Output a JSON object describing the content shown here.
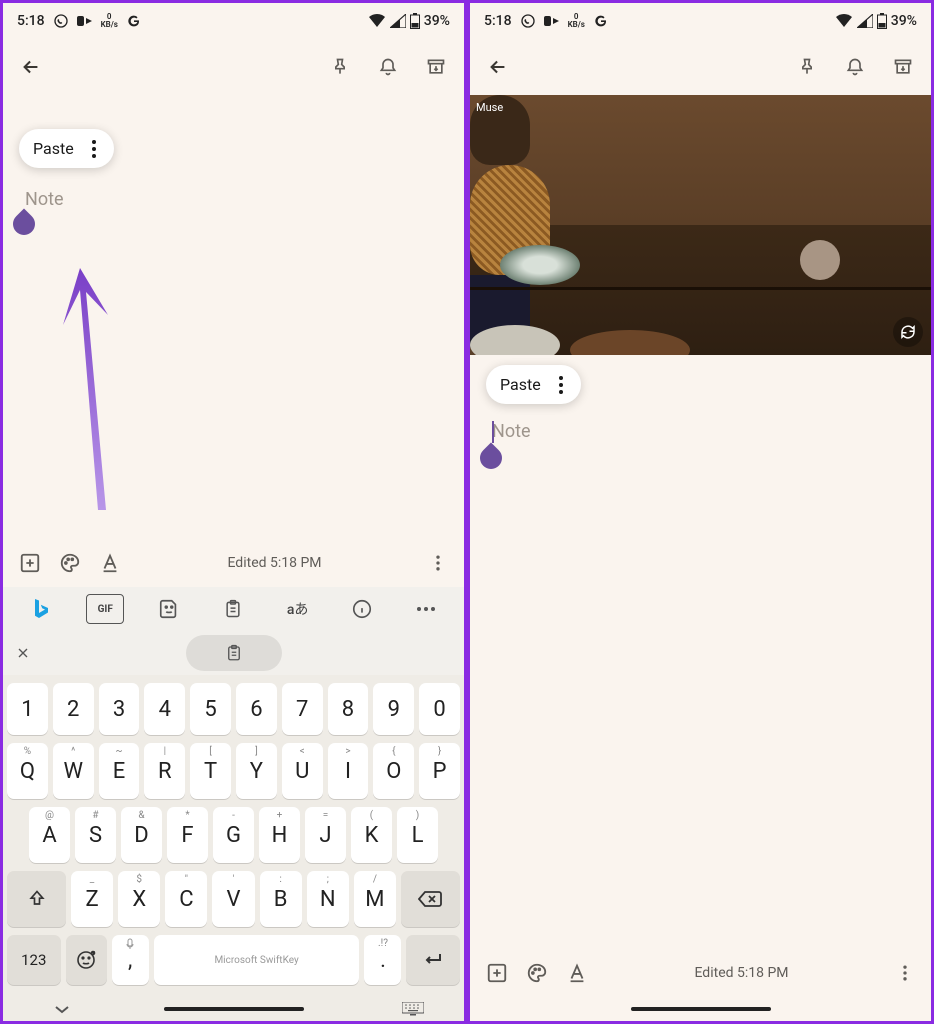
{
  "status": {
    "time": "5:18",
    "kb_num": "0",
    "kb_unit": "KB/s",
    "battery": "39%"
  },
  "left": {
    "paste_label": "Paste",
    "note_placeholder": "Note",
    "edited": "Edited 5:18 PM"
  },
  "right": {
    "paste_label": "Paste",
    "note_placeholder": "Note",
    "edited": "Edited 5:18 PM",
    "poster_text": "Muse"
  },
  "keyboard": {
    "gif": "GIF",
    "lang": "aあ",
    "row_num": [
      "1",
      "2",
      "3",
      "4",
      "5",
      "6",
      "7",
      "8",
      "9",
      "0"
    ],
    "row_q": [
      {
        "m": "Q",
        "s": "%"
      },
      {
        "m": "W",
        "s": "^"
      },
      {
        "m": "E",
        "s": "~"
      },
      {
        "m": "R",
        "s": "|"
      },
      {
        "m": "T",
        "s": "["
      },
      {
        "m": "Y",
        "s": "]"
      },
      {
        "m": "U",
        "s": "<"
      },
      {
        "m": "I",
        "s": ">"
      },
      {
        "m": "O",
        "s": "{"
      },
      {
        "m": "P",
        "s": "}"
      }
    ],
    "row_a": [
      {
        "m": "A",
        "s": "@"
      },
      {
        "m": "S",
        "s": "#"
      },
      {
        "m": "D",
        "s": "&"
      },
      {
        "m": "F",
        "s": "*"
      },
      {
        "m": "G",
        "s": "-"
      },
      {
        "m": "H",
        "s": "+"
      },
      {
        "m": "J",
        "s": "="
      },
      {
        "m": "K",
        "s": "("
      },
      {
        "m": "L",
        "s": ")"
      }
    ],
    "row_z": [
      "Z",
      "X",
      "C",
      "V",
      "B",
      "N",
      "M"
    ],
    "key_123": "123",
    "comma": ",",
    "space": "Microsoft SwiftKey",
    "period": ".",
    "period_sup": ".!?"
  }
}
